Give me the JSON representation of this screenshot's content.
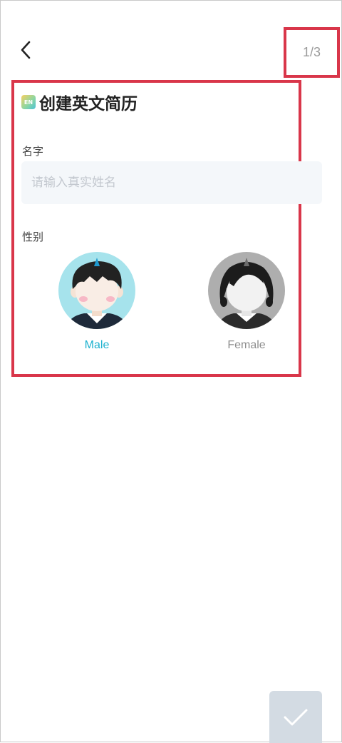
{
  "header": {
    "step_indicator": "1/3",
    "back_icon": "chevron-left-icon"
  },
  "title": {
    "badge_text": "EN",
    "text": "创建英文简历"
  },
  "form": {
    "name_label": "名字",
    "name_placeholder": "请输入真实姓名",
    "name_value": "",
    "gender_label": "性别",
    "gender_options": [
      {
        "label": "Male",
        "selected": true,
        "icon": "male-avatar-icon"
      },
      {
        "label": "Female",
        "selected": false,
        "icon": "female-avatar-icon"
      }
    ]
  },
  "footer": {
    "confirm_icon": "checkmark-icon"
  },
  "colors": {
    "accent": "#1fb2cf",
    "highlight": "#d9364a",
    "input_bg": "#f4f7fa",
    "confirm_bg": "#d3dbe3"
  }
}
